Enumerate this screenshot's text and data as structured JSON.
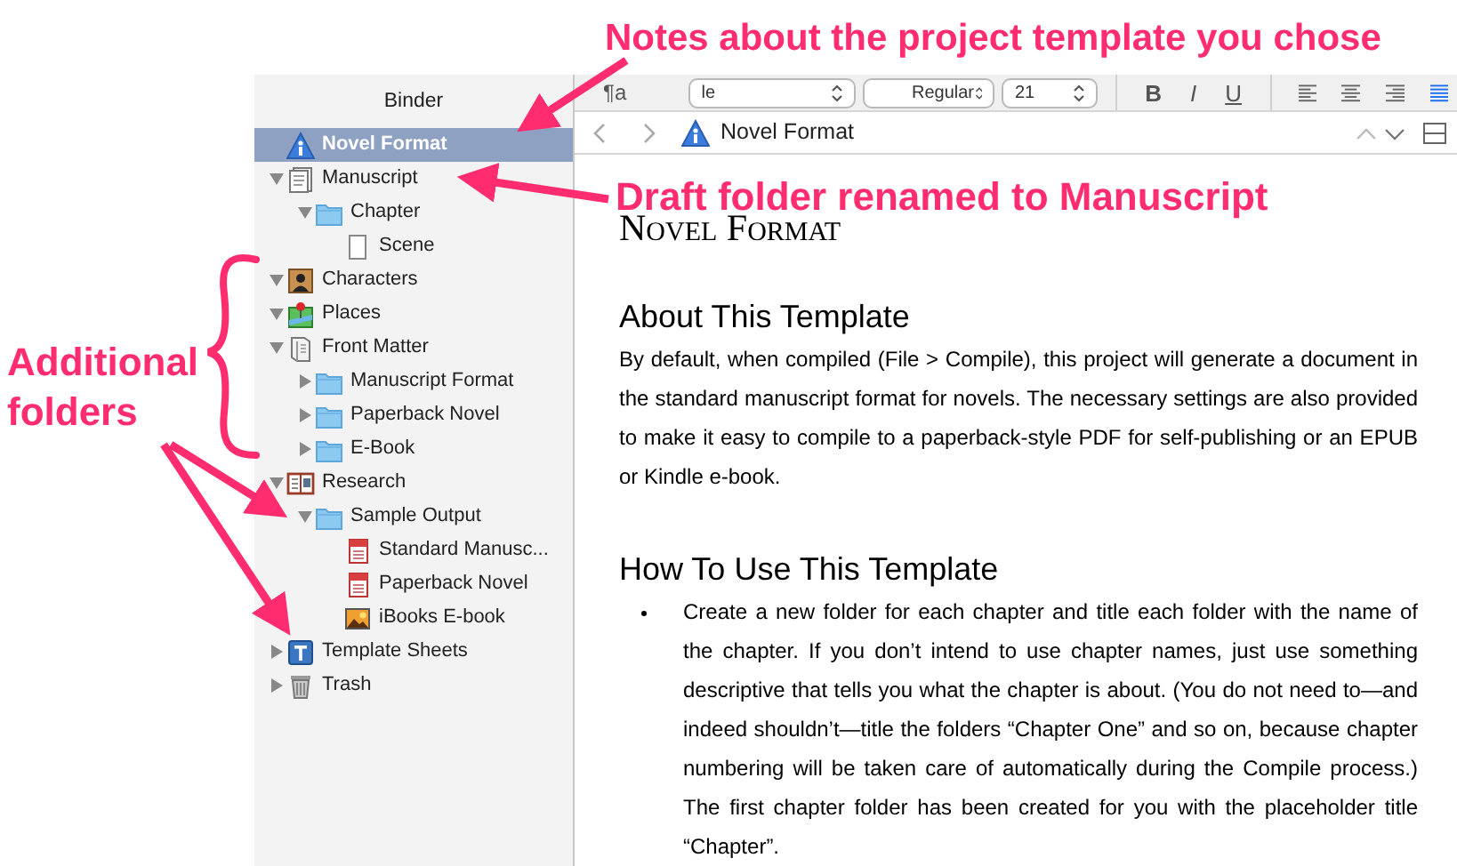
{
  "annotations": [
    {
      "text": "Notes about the project template you chose"
    },
    {
      "text": "Draft folder renamed to Manuscript"
    },
    {
      "text": "Additional folders"
    }
  ],
  "binder": {
    "title": "Binder",
    "items": [
      {
        "label": "Novel Format",
        "kind": "info",
        "selected": true
      },
      {
        "label": "Manuscript",
        "kind": "manuscript",
        "selected": false,
        "expanded": true,
        "children": [
          {
            "label": "Chapter",
            "kind": "folder",
            "selected": false,
            "expanded": true,
            "children": [
              {
                "label": "Scene",
                "kind": "page",
                "selected": false
              }
            ]
          }
        ]
      },
      {
        "label": "Characters",
        "kind": "characters",
        "selected": false,
        "expanded": true
      },
      {
        "label": "Places",
        "kind": "places",
        "selected": false,
        "expanded": true
      },
      {
        "label": "Front Matter",
        "kind": "front-matter",
        "selected": false,
        "expanded": true,
        "children": [
          {
            "label": "Manuscript Format",
            "kind": "folder",
            "selected": false,
            "expanded": false
          },
          {
            "label": "Paperback Novel",
            "kind": "folder",
            "selected": false,
            "expanded": false
          },
          {
            "label": "E-Book",
            "kind": "folder",
            "selected": false,
            "expanded": false
          }
        ]
      },
      {
        "label": "Research",
        "kind": "research",
        "selected": false,
        "expanded": true,
        "children": [
          {
            "label": "Sample Output",
            "kind": "folder",
            "selected": false,
            "expanded": true,
            "children": [
              {
                "label": "Standard Manusc...",
                "kind": "pdf",
                "selected": false
              },
              {
                "label": "Paperback Novel",
                "kind": "pdf",
                "selected": false
              },
              {
                "label": "iBooks E-book",
                "kind": "image",
                "selected": false
              }
            ]
          }
        ]
      },
      {
        "label": "Template Sheets",
        "kind": "template",
        "selected": false,
        "expanded": false
      },
      {
        "label": "Trash",
        "kind": "trash",
        "selected": false,
        "expanded": false
      }
    ]
  },
  "format_bar": {
    "paragraph_style": "¶a",
    "font_family": "le",
    "font_style": "Regular",
    "font_size": "21",
    "text_styles": [
      {
        "label": "B",
        "kind": "bold"
      },
      {
        "label": "I",
        "kind": "italic"
      },
      {
        "label": "U",
        "kind": "underline"
      }
    ],
    "alignments": [
      {
        "kind": "left",
        "selected": false
      },
      {
        "kind": "center",
        "selected": false
      },
      {
        "kind": "right",
        "selected": false
      },
      {
        "kind": "justify",
        "selected": true
      }
    ]
  },
  "editor": {
    "header": {
      "title": "Novel Format"
    },
    "document": {
      "title": "Novel Format",
      "sections": [
        {
          "heading": "About This Template",
          "kind": "paragraph",
          "text": "By default, when compiled (File > Compile), this project will generate a document in the standard manuscript format for novels. The necessary settings are also provided to make it easy to compile to a paperback-style PDF for self-publishing or an EPUB or Kindle e-book."
        },
        {
          "heading": "How To Use This Template",
          "kind": "bullet",
          "text": "Create a new folder for each chapter and title each folder with the name of the chapter. If you don’t intend to use chapter names, just use something descriptive that tells you what the chapter is about. (You do not need to—and indeed shouldn’t—title the folders “Chapter One” and so on, because chapter numbering will be taken care of automatically during the Compile process.) The first chapter folder has been created for you with the placeholder title “Chapter”."
        }
      ]
    }
  }
}
